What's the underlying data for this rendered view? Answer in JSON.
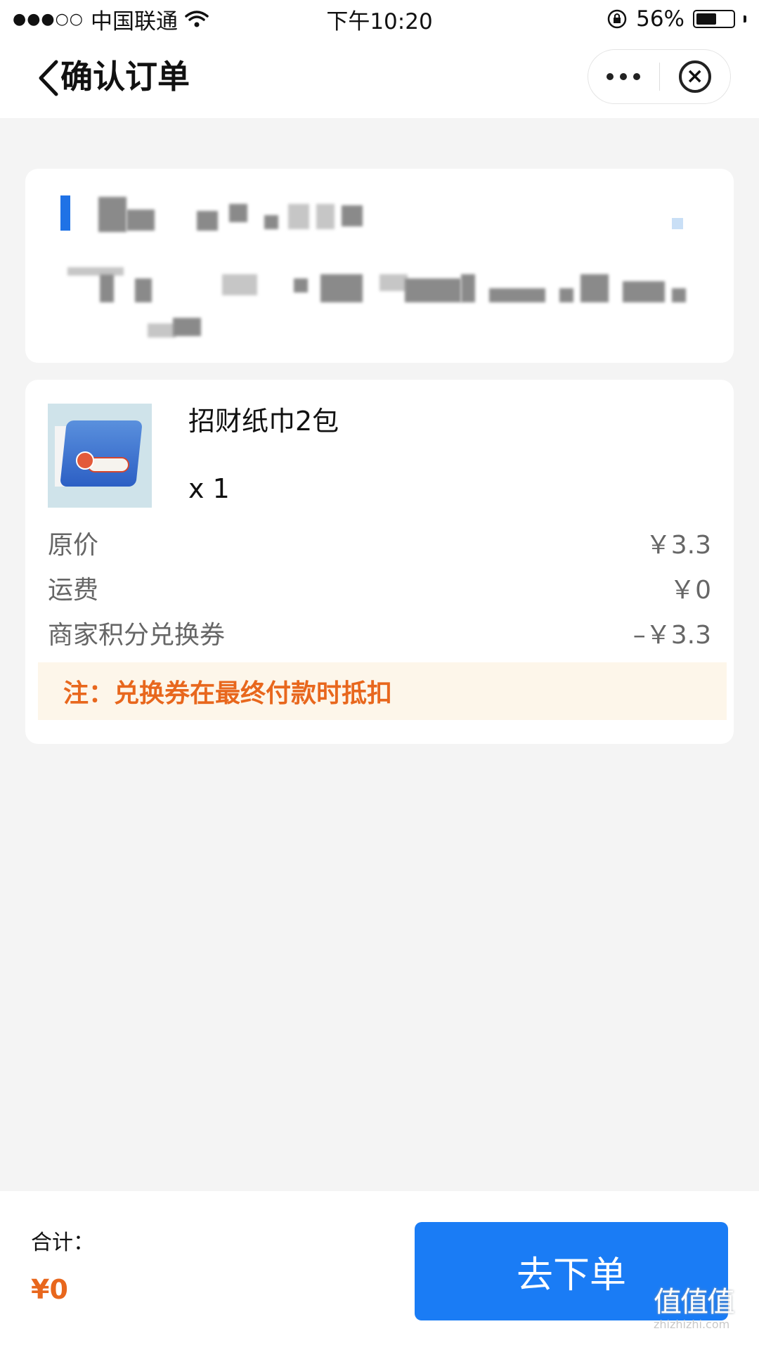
{
  "status_bar": {
    "carrier": "中国联通",
    "signal": "●●●○○",
    "time": "下午10:20",
    "battery_percent": "56%",
    "battery_level": 0.56
  },
  "nav": {
    "title": "确认订单"
  },
  "product": {
    "name": "招财纸巾2包",
    "quantity": "x 1"
  },
  "fees": [
    {
      "label": "原价",
      "value": "￥3.3"
    },
    {
      "label": "运费",
      "value": "￥0"
    },
    {
      "label": "商家积分兑换券",
      "value": "–￥3.3"
    }
  ],
  "note": "注：兑换券在最终付款时抵扣",
  "footer": {
    "total_label": "合计：",
    "total_value": "¥0",
    "submit_label": "去下单"
  },
  "watermark": {
    "main": "值值值",
    "sub": "zhizhizhi.com"
  },
  "colors": {
    "accent_blue": "#1a7cf5",
    "accent_orange": "#e8671d",
    "note_bg": "#fdf6ea"
  }
}
